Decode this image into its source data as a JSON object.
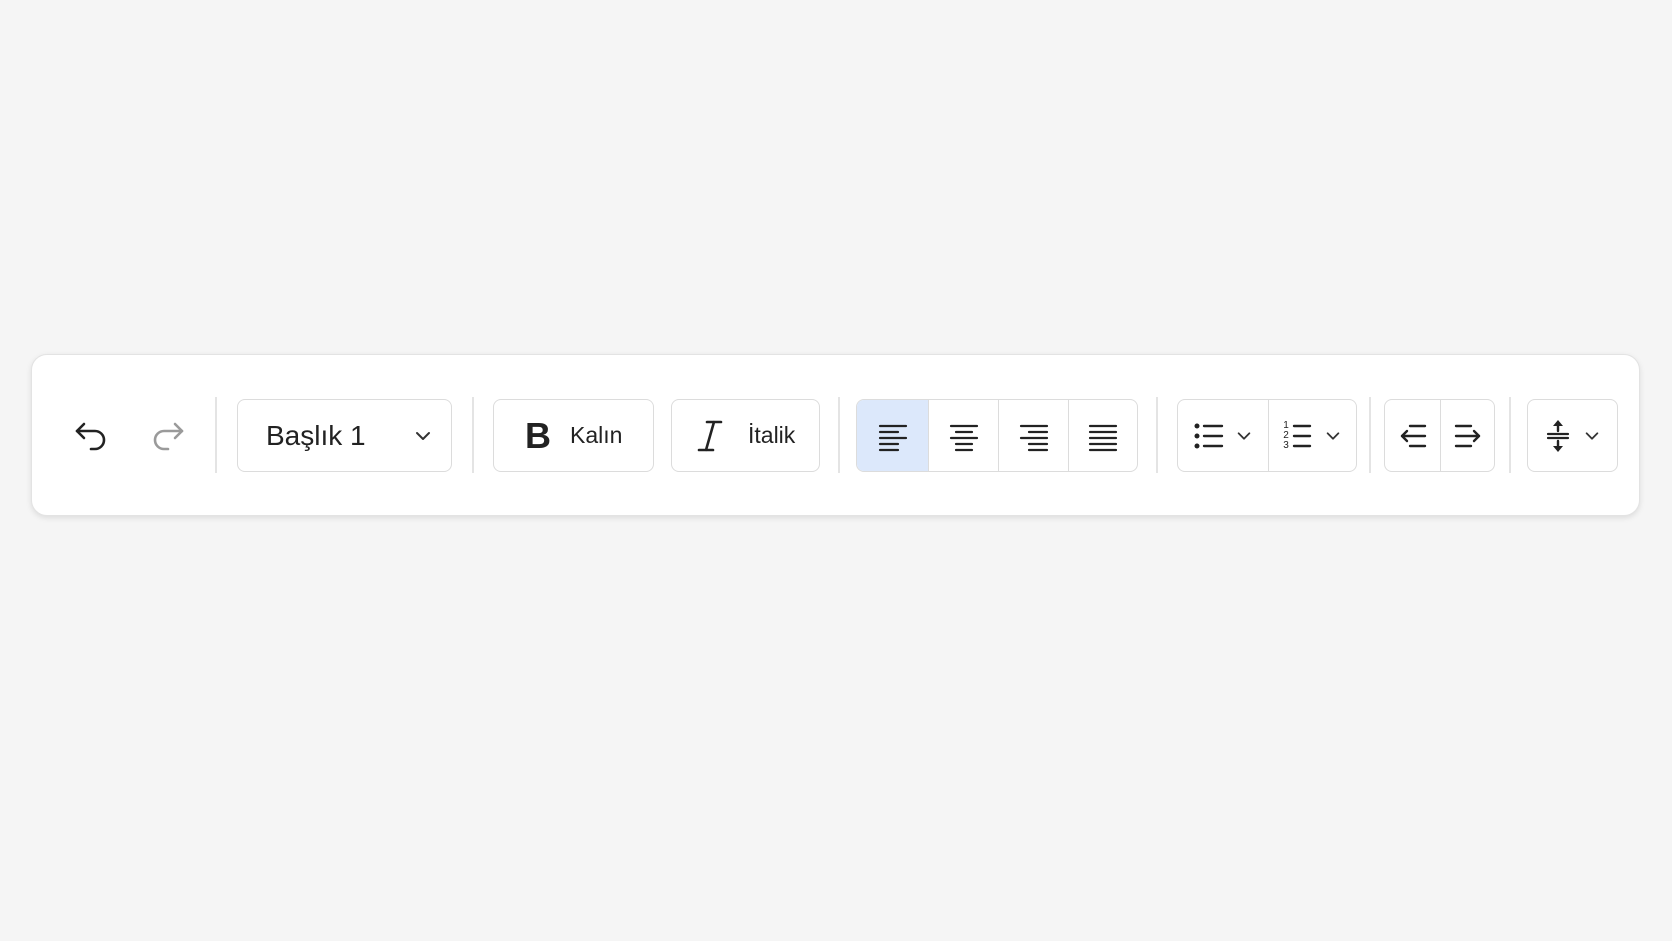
{
  "toolbar": {
    "undo_icon": "undo-icon",
    "redo_icon": "redo-icon",
    "paragraph_style": {
      "selected": "Başlık 1",
      "icon": "chevron-down-icon"
    },
    "bold": {
      "label": "Kalın",
      "icon": "bold-icon"
    },
    "italic": {
      "label": "İtalik",
      "icon": "italic-icon"
    },
    "alignment": {
      "selected": "left",
      "options": [
        "align-left-icon",
        "align-center-icon",
        "align-right-icon",
        "align-justify-icon"
      ]
    },
    "lists": {
      "bulleted_icon": "bulleted-list-icon",
      "numbered_icon": "numbered-list-icon",
      "numbered_digits": [
        "1",
        "2",
        "3"
      ]
    },
    "indent": {
      "decrease_icon": "outdent-icon",
      "increase_icon": "indent-icon"
    },
    "line_spacing_icon": "line-spacing-icon"
  },
  "colors": {
    "background": "#f5f5f5",
    "toolbar": "#ffffff",
    "active_segment": "#dce8fb",
    "border": "#dcdcdc",
    "icon": "#222222",
    "disabled_icon": "#9a9a9a"
  }
}
